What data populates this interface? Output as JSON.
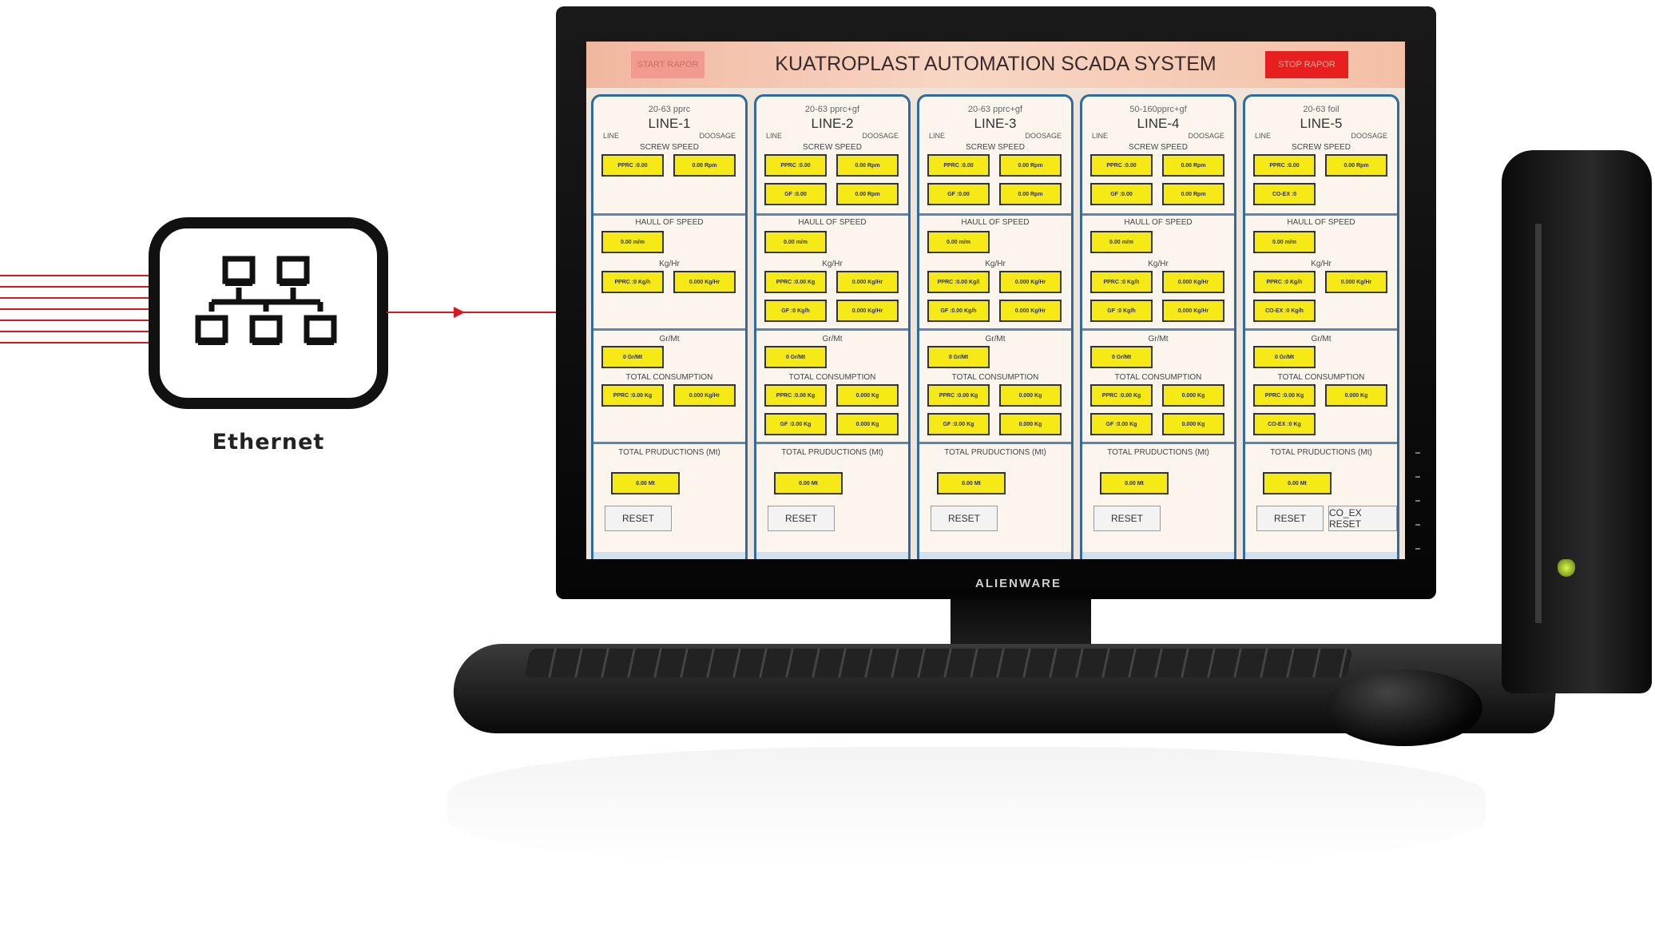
{
  "ethernet": {
    "label": "Ethernet",
    "icon": "network-topology-icon",
    "line_color": "#d9181f"
  },
  "scada": {
    "title": "KUATROPLAST AUTOMATION SCADA SYSTEM",
    "start_button": "START RAPOR",
    "stop_button": "STOP RAPOR",
    "stop_color": "#e81f1f",
    "value_box_color": "#f5ea16",
    "lines": [
      {
        "product": "20-63 pprc",
        "name": "LINE-1",
        "col_line": "LINE",
        "col_dosage": "DOOSAGE",
        "screw_speed": [
          "PPRC :0.00",
          "0.00 Rpm"
        ],
        "haul_of_speed": "0.00 m/m",
        "kg_hr": [
          "PPRC :0 Kg/h",
          "0.000 Kg/Hr"
        ],
        "gr_mt": "0 Gr/Mt",
        "total_consumption": [
          "PPRC :0.00 Kg",
          "0.000 Kg/Hr"
        ],
        "total_productions": "0.00 Mt",
        "reset": "RESET"
      },
      {
        "product": "20-63 pprc+gf",
        "name": "LINE-2",
        "col_line": "LINE",
        "col_dosage": "DOOSAGE",
        "screw_speed": [
          "PPRC :0.00",
          "0.00 Rpm",
          "GF :0.00",
          "0.00 Rpm"
        ],
        "haul_of_speed": "0.00 m/m",
        "kg_hr": [
          "PPRC :0.00 Kg",
          "0.000 Kg/Hr",
          "GF :0 Kg/h",
          "0.000 Kg/Hr"
        ],
        "gr_mt": "0 Gr/Mt",
        "total_consumption": [
          "PPRC :0.00 Kg",
          "0.000 Kg",
          "GF :0.00 Kg",
          "0.000 Kg"
        ],
        "total_productions": "0.00 Mt",
        "reset": "RESET"
      },
      {
        "product": "20-63 pprc+gf",
        "name": "LINE-3",
        "col_line": "LINE",
        "col_dosage": "DOOSAGE",
        "screw_speed": [
          "PPRC :0.00",
          "0.00 Rpm",
          "GF :0.00",
          "0.00 Rpm"
        ],
        "haul_of_speed": "0.00 m/m",
        "kg_hr": [
          "PPRC :0.00 Kg/l",
          "0.000 Kg/Hr",
          "GF :0.00 Kg/h",
          "0.000 Kg/Hr"
        ],
        "gr_mt": "0 Gr/Mt",
        "total_consumption": [
          "PPRC :0.00 Kg",
          "0.000 Kg",
          "GF :0.00 Kg",
          "0.000 Kg"
        ],
        "total_productions": "0.00 Mt",
        "reset": "RESET"
      },
      {
        "product": "50-160pprc+gf",
        "name": "LINE-4",
        "col_line": "LINE",
        "col_dosage": "DOOSAGE",
        "screw_speed": [
          "PPRC :0.00",
          "0.00 Rpm",
          "GF :0.00",
          "0.00 Rpm"
        ],
        "haul_of_speed": "0.00 m/m",
        "kg_hr": [
          "PPRC :0 Kg/h",
          "0.000 Kg/Hr",
          "GF :0 Kg/h",
          "0.000 Kg/Hr"
        ],
        "gr_mt": "0 Gr/Mt",
        "total_consumption": [
          "PPRC :0.00 Kg",
          "0.000 Kg",
          "GF :0.00 Kg",
          "0.000 Kg"
        ],
        "total_productions": "0.00 Mt",
        "reset": "RESET"
      },
      {
        "product": "20-63 foil",
        "name": "LINE-5",
        "col_line": "LINE",
        "col_dosage": "DOOSAGE",
        "screw_speed": [
          "PPRC :0.00",
          "0.00 Rpm",
          "CO-EX :0"
        ],
        "haul_of_speed": "0.00 m/m",
        "kg_hr": [
          "PPRC :0 Kg/h",
          "0.000 Kg/Hr",
          "CO-EX :0 Kg/h"
        ],
        "gr_mt": "0 Gr/Mt",
        "total_consumption": [
          "PPRC :0.00 Kg",
          "0.000 Kg",
          "CO-EX :0 Kg"
        ],
        "total_productions": "0.00 Mt",
        "reset": "RESET",
        "coex_reset": "CO_EX RESET"
      }
    ],
    "section_labels": {
      "screw_speed": "SCREW SPEED",
      "haul_of_speed": "HAULL OF SPEED",
      "kg_hr": "Kg/Hr",
      "gr_mt": "Gr/Mt",
      "total_consumption": "TOTAL CONSUMPTION",
      "total_productions": "TOTAL PRUDUCTIONS (Mt)"
    }
  },
  "monitor": {
    "brand": "ALIENWARE"
  }
}
